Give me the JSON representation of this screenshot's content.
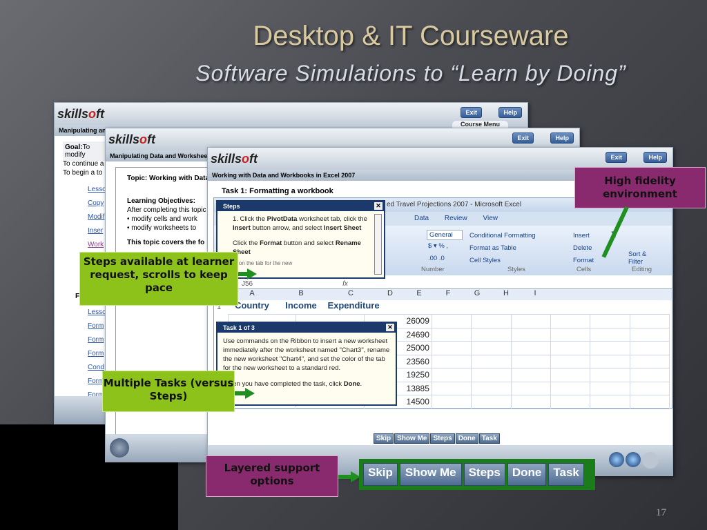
{
  "slide": {
    "title": "Desktop & IT Courseware",
    "subtitle": "Software Simulations to “Learn by Doing”",
    "page_number": "17"
  },
  "window_common": {
    "logo": "skillsoft",
    "exit": "Exit",
    "help": "Help"
  },
  "window1": {
    "subtitle": "Manipulating and Formatting Data and Worksheets",
    "course_menu": "Course Menu",
    "goal_label": "Goal:",
    "goal_text": "To modify",
    "intro1": "To continue a",
    "intro2": "To begin a to",
    "links": [
      "Lesso",
      "Copy",
      "Modif",
      "Inser",
      "Work"
    ],
    "section": "F",
    "links2": [
      "Lesso",
      "Form",
      "Form",
      "Form",
      "Cond",
      "Form",
      "Form"
    ]
  },
  "window2": {
    "subtitle": "Manipulating Data and Worksheets",
    "topic": "Topic: Working with Data",
    "objectives_title": "Learning Objectives:",
    "objectives_intro": "After completing this topic",
    "bullets": [
      "modify cells and work",
      "modify worksheets to"
    ],
    "covers": "This topic covers the fo"
  },
  "window3": {
    "subtitle": "Working with Data and Workbooks in Excel 2007",
    "task_title": "Task 1: Formatting a workbook",
    "excel": {
      "title": "ed Travel Projections 2007 - Microsoft Excel",
      "tabs": [
        "Data",
        "Review",
        "View"
      ],
      "number_format": "General",
      "number_group": "Number",
      "styles": [
        "Conditional Formatting",
        "Format as Table",
        "Cell Styles"
      ],
      "styles_group": "Styles",
      "cells": [
        "Insert",
        "Delete",
        "Format"
      ],
      "cells_group": "Cells",
      "editing": "Sort & Filter",
      "editing_group": "Editing",
      "name_box": "J56",
      "fx": "fx",
      "columns": [
        "A",
        "B",
        "C",
        "D",
        "E",
        "F",
        "G",
        "H",
        "I"
      ],
      "headers": [
        "Country",
        "Income",
        "Expenditure"
      ],
      "row1": "1",
      "expenditure": [
        "26009",
        "24690",
        "25000",
        "23560",
        "19250",
        "13885",
        "14500"
      ]
    },
    "steps_panel": {
      "title": "Steps",
      "step1_pre": "1. Click the ",
      "step1_b1": "PivotData",
      "step1_mid": " worksheet tab, click the ",
      "step1_b2": "Insert",
      "step1_mid2": " button arrow, and select ",
      "step1_b3": "Insert Sheet",
      "step2_pre": "Click the ",
      "step2_b1": "Format",
      "step2_mid": " button and select ",
      "step2_b2": "Rename Sheet",
      "step3": "... on the tab for the new"
    },
    "task_panel": {
      "title": "Task 1 of 3",
      "text": "Use commands on the Ribbon to insert a new worksheet immediately after the worksheet named \"Chart3\", rename the new worksheet \"Chart4\", and set the color of the tab for the new worksheet to a standard red.",
      "done_pre": "When you have completed the task, click ",
      "done_b": "Done",
      "done_post": "."
    },
    "buttons": [
      "Skip",
      "Show Me",
      "Steps",
      "Done",
      "Task"
    ]
  },
  "callouts": {
    "steps": "Steps available at learner request, scrolls to keep pace",
    "tasks": "Multiple Tasks (versus Steps)",
    "fidelity": "High fidelity environment",
    "layered": "Layered support options"
  },
  "big_buttons": [
    "Skip",
    "Show Me",
    "Steps",
    "Done",
    "Task"
  ]
}
